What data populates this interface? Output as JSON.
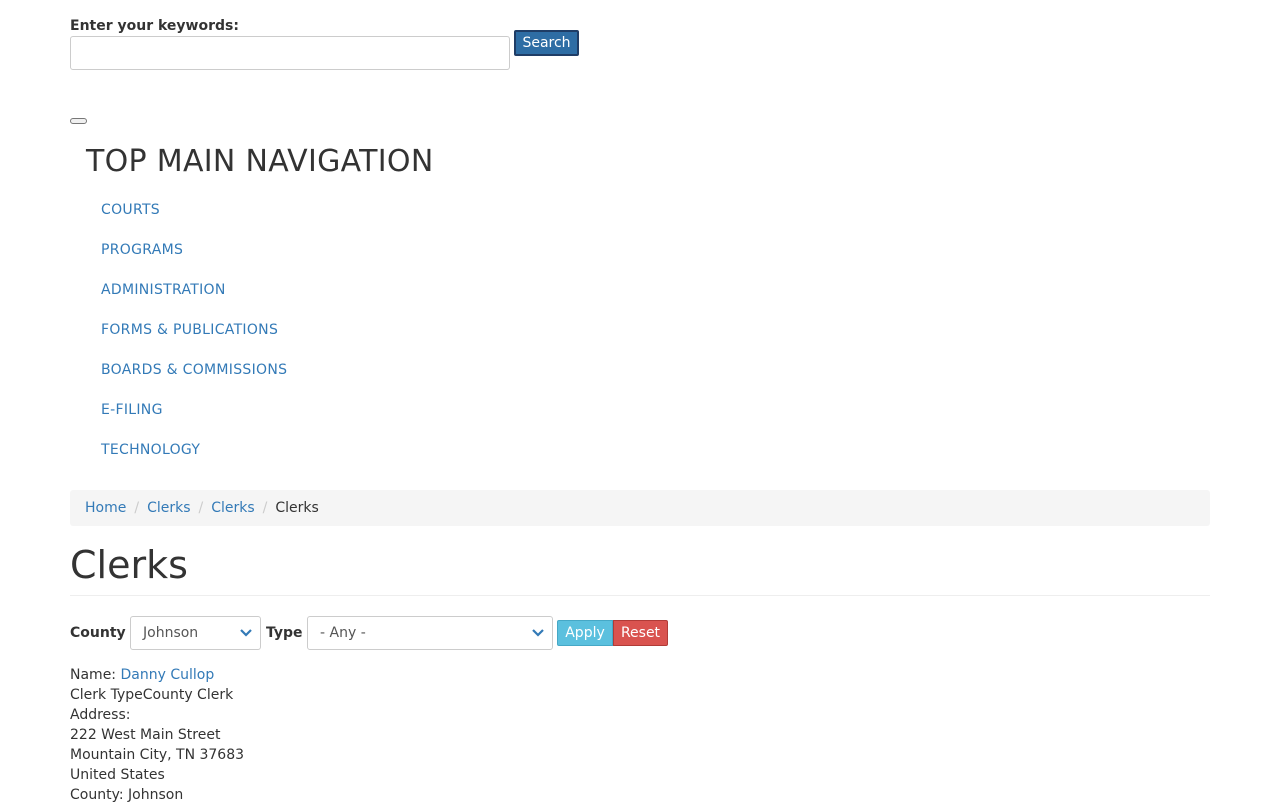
{
  "search": {
    "label": "Enter your keywords:",
    "input_value": "",
    "button_label": "Search"
  },
  "nav": {
    "title": "TOP MAIN NAVIGATION",
    "items": [
      {
        "label": "COURTS"
      },
      {
        "label": "PROGRAMS"
      },
      {
        "label": "ADMINISTRATION"
      },
      {
        "label": "FORMS & PUBLICATIONS"
      },
      {
        "label": "BOARDS & COMMISSIONS"
      },
      {
        "label": "E-FILING"
      },
      {
        "label": "TECHNOLOGY"
      }
    ]
  },
  "breadcrumb": {
    "items": [
      {
        "label": "Home"
      },
      {
        "label": "Clerks"
      },
      {
        "label": "Clerks"
      }
    ],
    "current": "Clerks",
    "separator": "/"
  },
  "page": {
    "title": "Clerks"
  },
  "filters": {
    "county_label": "County",
    "county_value": "Johnson",
    "type_label": "Type",
    "type_value": "- Any -",
    "apply_label": "Apply",
    "reset_label": "Reset"
  },
  "record": {
    "name_label": "Name: ",
    "name_value": "Danny Cullop",
    "clerk_type_label": "Clerk Type",
    "clerk_type_value": "County Clerk",
    "address_label": "Address:",
    "address_line1": "222 West Main Street",
    "address_line2": "Mountain City, TN 37683",
    "address_country": "United States",
    "county_label": "County: ",
    "county_value": "Johnson"
  },
  "colors": {
    "link": "#337ab7",
    "search_button": "#2e6da4",
    "apply_button": "#5bc0de",
    "reset_button": "#d9534f",
    "breadcrumb_bg": "#f5f5f5"
  }
}
